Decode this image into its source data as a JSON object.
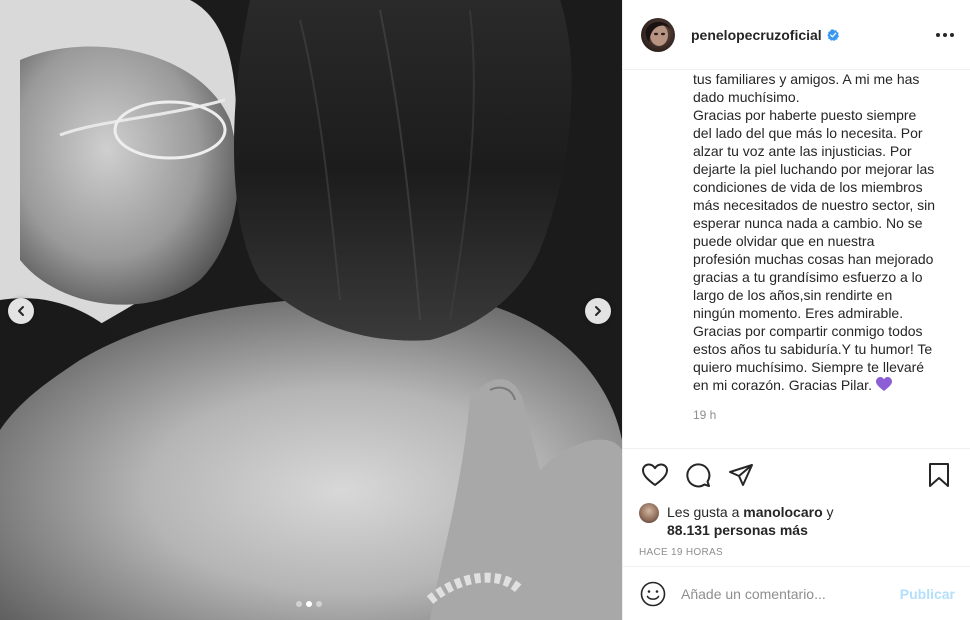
{
  "post": {
    "media": {
      "carousel_dots": 3,
      "active_dot": 1,
      "left_arrow_icon": "chevron-left-icon",
      "right_arrow_icon": "chevron-right-icon"
    },
    "header": {
      "username": "penelopecruzoficial",
      "verified_icon": "verified-badge-icon",
      "more_icon": "more-options-icon"
    },
    "caption": {
      "text": "tus familiares y amigos. A mi me has\ndado muchísimo.\nGracias por haberte puesto siempre\ndel lado del que más lo necesita. Por\nalzar tu voz ante las injusticias. Por\ndejarte la piel luchando por mejorar las\ncondiciones de vida de los miembros\nmás necesitados de nuestro sector, sin\nesperar nunca nada a cambio. No se\npuede olvidar que en nuestra\nprofesión muchas cosas han mejorado\ngracias a tu grandísimo esfuerzo a lo\nlargo de los años,sin rendirte en\nningún momento. Eres admirable.\nGracias por compartir conmigo todos\nestos años tu sabiduría.Y tu humor! Te\nquiero muchísimo. Siempre te llevaré\nen mi corazón. Gracias Pilar. ",
      "emoji": "purple-heart",
      "time_ago": "19 h"
    },
    "actions": {
      "like_icon": "heart-icon",
      "comment_icon": "comment-icon",
      "share_icon": "share-icon",
      "save_icon": "bookmark-icon"
    },
    "likes": {
      "prefix": "Les gusta a ",
      "first_liker": "manolocaro",
      "conjunction": " y",
      "others": "88.131 personas más"
    },
    "timestamp": "Hace 19 horas",
    "comment": {
      "placeholder": "Añade un comentario...",
      "publish_label": "Publicar",
      "emoji_icon": "smiley-icon"
    }
  },
  "colors": {
    "text": "#262626",
    "secondary": "#8e8e8e",
    "verified": "#3897f0",
    "publish_disabled": "#b2dffc",
    "emoji_heart": "#8c5fd6",
    "border": "#efefef"
  }
}
